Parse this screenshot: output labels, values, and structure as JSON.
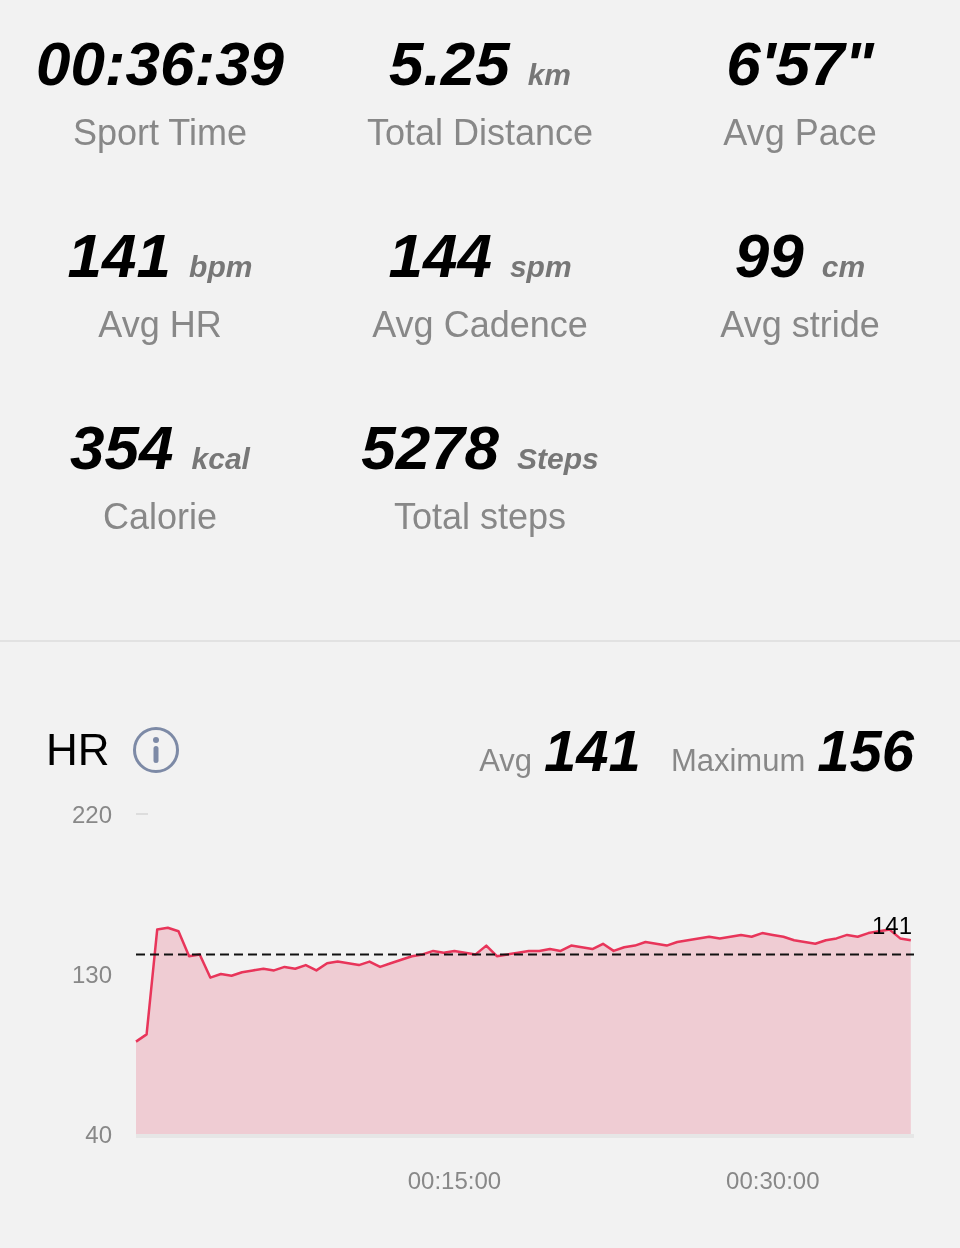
{
  "metrics": [
    {
      "value": "00:36:39",
      "label": "Sport Time"
    },
    {
      "value": "5.25",
      "unit": "km",
      "label": "Total Distance"
    },
    {
      "value": "6'57\"",
      "label": "Avg Pace"
    },
    {
      "value": "141",
      "unit": "bpm",
      "label": "Avg HR"
    },
    {
      "value": "144",
      "unit": "spm",
      "label": "Avg Cadence"
    },
    {
      "value": "99",
      "unit": "cm",
      "label": "Avg stride"
    },
    {
      "value": "354",
      "unit": "kcal",
      "label": "Calorie"
    },
    {
      "value": "5278",
      "unit": "Steps",
      "label": "Total steps"
    }
  ],
  "hr": {
    "title": "HR",
    "stats": [
      {
        "label": "Avg",
        "value": "141"
      },
      {
        "label": "Maximum",
        "value": "156"
      }
    ],
    "chart_data": {
      "type": "area",
      "xlim": [
        0,
        36.65
      ],
      "ylim": [
        40,
        220
      ],
      "yticks": [
        40,
        130,
        220
      ],
      "xticks": [
        {
          "value": 15,
          "label": "00:15:00"
        },
        {
          "value": 30,
          "label": "00:30:00"
        }
      ],
      "ref_lines": [
        {
          "axis": "y",
          "value": 141,
          "label": "141",
          "color": "#111111"
        }
      ],
      "x": [
        0,
        0.5,
        1,
        1.5,
        2,
        2.5,
        3,
        3.5,
        4,
        4.5,
        5,
        5.5,
        6,
        6.5,
        7,
        7.5,
        8,
        8.5,
        9,
        9.5,
        10,
        10.5,
        11,
        11.5,
        12,
        12.5,
        13,
        13.5,
        14,
        14.5,
        15,
        15.5,
        16,
        16.5,
        17,
        17.5,
        18,
        18.5,
        19,
        19.5,
        20,
        20.5,
        21,
        21.5,
        22,
        22.5,
        23,
        23.5,
        24,
        24.5,
        25,
        25.5,
        26,
        26.5,
        27,
        27.5,
        28,
        28.5,
        29,
        29.5,
        30,
        30.5,
        31,
        31.5,
        32,
        32.5,
        33,
        33.5,
        34,
        34.5,
        35,
        35.5,
        36,
        36.5
      ],
      "series": [
        {
          "color": "#e8355a",
          "values": [
            92,
            96,
            155,
            156,
            154,
            140,
            141,
            128,
            130,
            129,
            131,
            132,
            133,
            132,
            134,
            133,
            135,
            132,
            136,
            137,
            136,
            135,
            137,
            134,
            136,
            138,
            140,
            141,
            143,
            142,
            143,
            142,
            141,
            146,
            140,
            141,
            142,
            143,
            143,
            144,
            143,
            146,
            145,
            144,
            147,
            143,
            145,
            146,
            148,
            147,
            146,
            148,
            149,
            150,
            151,
            150,
            151,
            152,
            151,
            153,
            152,
            151,
            149,
            148,
            147,
            149,
            150,
            152,
            151,
            153,
            154,
            155,
            150,
            149
          ]
        }
      ]
    }
  }
}
